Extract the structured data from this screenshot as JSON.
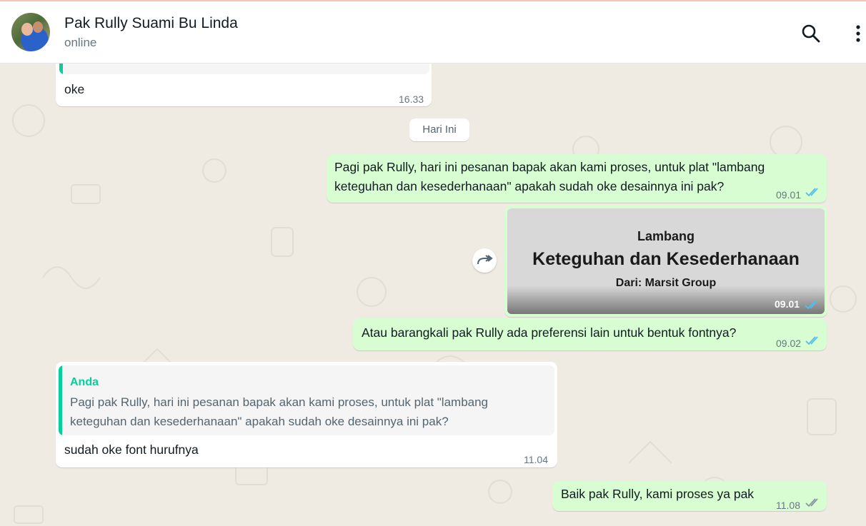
{
  "header": {
    "contact_name": "Pak Rully Suami Bu Linda",
    "status": "online",
    "icons": [
      "avatar",
      "search-icon",
      "more-vert-icon"
    ]
  },
  "chat": {
    "date_separator": "Hari Ini",
    "messages": [
      {
        "direction": "incoming",
        "text": "oke",
        "time": "16.33",
        "has_reply_quote": true
      },
      {
        "direction": "outgoing",
        "text": "Pagi pak Rully, hari ini pesanan bapak akan kami proses, untuk plat \"lambang keteguhan dan kesederhanaan\" apakah sudah oke desainnya ini pak?",
        "time": "09.01",
        "status": "read"
      },
      {
        "direction": "outgoing",
        "type": "image",
        "image_text": {
          "line1": "Lambang",
          "line2": "Keteguhan dan Kesederhanaan",
          "line3": "Dari: Marsit Group"
        },
        "time": "09.01",
        "status": "read"
      },
      {
        "direction": "outgoing",
        "text": "Atau barangkali pak Rully ada preferensi lain untuk bentuk fontnya?",
        "time": "09.02",
        "status": "read"
      },
      {
        "direction": "incoming",
        "quote": {
          "author": "Anda",
          "text": "Pagi pak Rully, hari ini pesanan bapak akan kami proses, untuk plat \"lambang keteguhan dan kesederhanaan\" apakah sudah oke desainnya ini pak?"
        },
        "text": "sudah oke font hurufnya",
        "time": "11.04"
      },
      {
        "direction": "outgoing",
        "text": "Baik pak Rully, kami proses ya pak",
        "time": "11.08",
        "status": "delivered"
      }
    ]
  },
  "colors": {
    "incoming_bubble": "#ffffff",
    "outgoing_bubble": "#d9fdd3",
    "quote_accent": "#06cf9c",
    "read_tick": "#53bdeb",
    "delivered_tick": "#8696a0",
    "chat_background": "#efeae2"
  }
}
